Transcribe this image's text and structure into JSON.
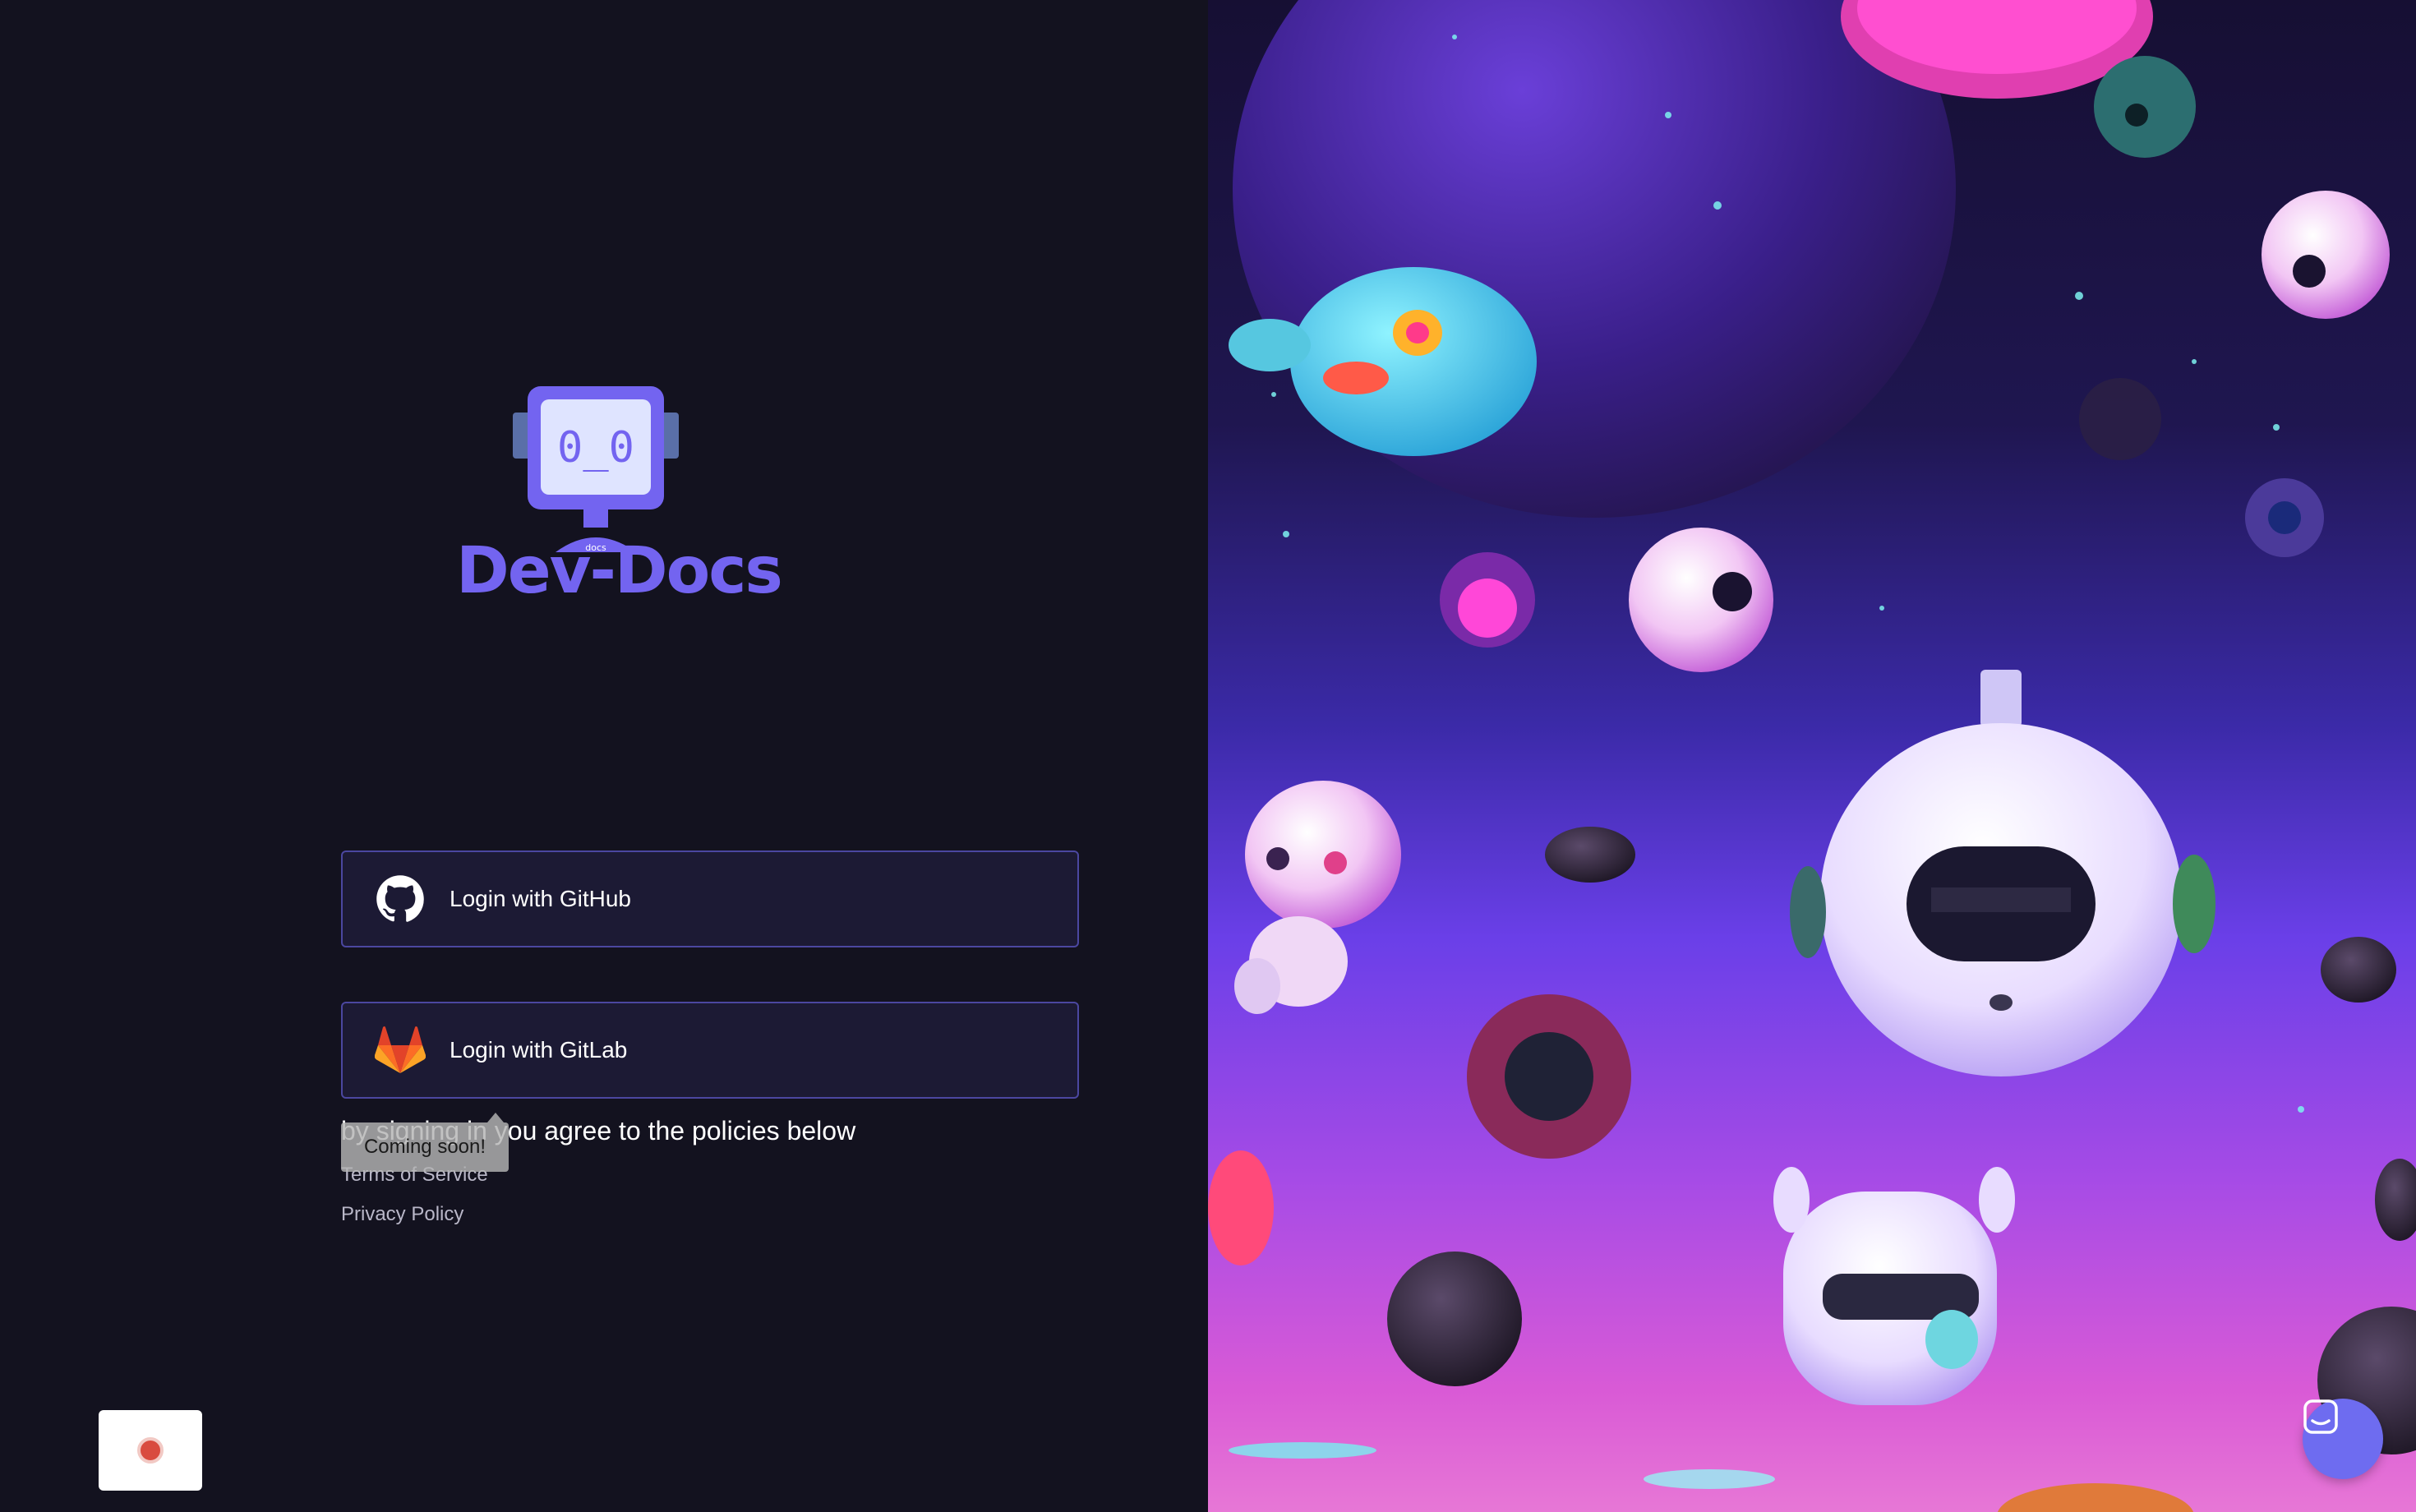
{
  "brand": {
    "name": "Dev-Docs",
    "logo_screen_text": "0_0",
    "logo_stand_text": "docs",
    "accent": "#7364f0"
  },
  "auth": {
    "github_label": "Login with GitHub",
    "gitlab_label": "Login with GitLab",
    "github_icon": "github-icon",
    "gitlab_icon": "gitlab-icon"
  },
  "policies": {
    "intro": "by signing in you agree to the policies below",
    "terms_label": "Terms of Service",
    "privacy_label": "Privacy Policy",
    "tooltip": "Coming soon!"
  },
  "widgets": {
    "record_icon": "record-icon",
    "chat_icon": "chat-icon"
  },
  "colors": {
    "background": "#13121f",
    "button_bg": "#1c1a34",
    "button_border": "#4b47a0",
    "record_red": "#d94b3f",
    "chat_bg": "#6e6cf0"
  }
}
